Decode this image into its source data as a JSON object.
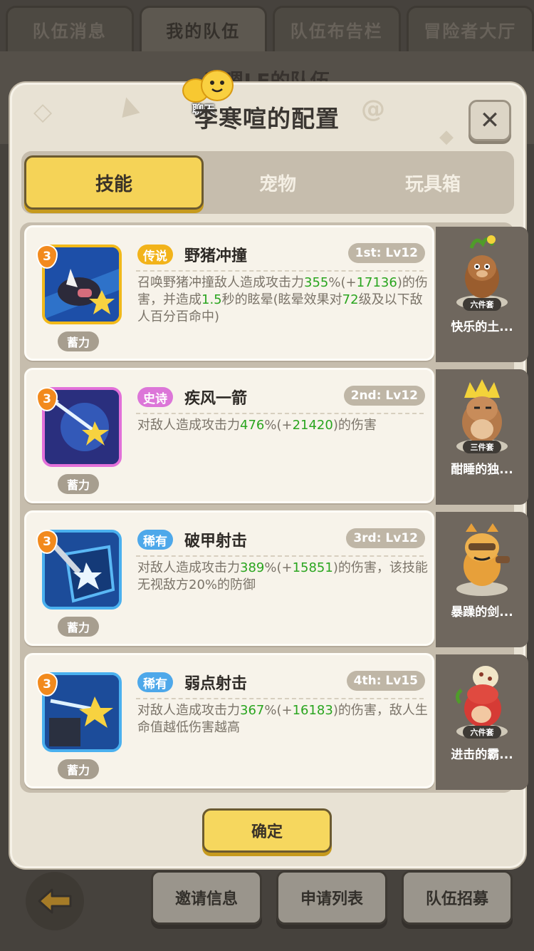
{
  "top_tabs": [
    "队伍消息",
    "我的队伍",
    "队伍布告栏",
    "冒险者大厅"
  ],
  "behind_title": "叫嗯LE的队伍",
  "chat_label": "聊天",
  "dialog_title": "李寒喧的配置",
  "tabs": [
    "技能",
    "宠物",
    "玩具箱"
  ],
  "charge_label": "蓄力",
  "skills": [
    {
      "level": "3",
      "rarity": "传说",
      "rarity_color": "#f2b31a",
      "name": "野猪冲撞",
      "slot": "1st: Lv12",
      "desc": [
        "召唤野猪冲撞敌人造成攻击力",
        "355",
        "%(+",
        "17136",
        ")的伤害，并造成",
        "1.5",
        "秒的眩晕(眩晕效果对",
        "72",
        "级及以下敌人百分百命中)"
      ]
    },
    {
      "level": "3",
      "rarity": "史诗",
      "rarity_color": "#dc76d8",
      "name": "疾风一箭",
      "slot": "2nd: Lv12",
      "desc": [
        "对敌人造成攻击力",
        "476",
        "%(+",
        "21420",
        ")的伤害",
        "",
        "",
        "",
        ""
      ]
    },
    {
      "level": "3",
      "rarity": "稀有",
      "rarity_color": "#4ea8ea",
      "name": "破甲射击",
      "slot": "3rd: Lv12",
      "desc": [
        "对敌人造成攻击力",
        "389",
        "%(+",
        "15851",
        ")的伤害，该技能无视敌方20%的防御",
        "",
        "",
        "",
        ""
      ]
    },
    {
      "level": "3",
      "rarity": "稀有",
      "rarity_color": "#4ea8ea",
      "name": "弱点射击",
      "slot": "4th: Lv15",
      "desc": [
        "对敌人造成攻击力",
        "367",
        "%(+",
        "16183",
        ")的伤害，敌人生命值越低伤害越高",
        "",
        "",
        "",
        ""
      ]
    }
  ],
  "pets": [
    {
      "tag": "六件套",
      "name": "快乐的土..."
    },
    {
      "tag": "三件套",
      "name": "酣睡的独..."
    },
    {
      "tag": "",
      "name": "暴躁的剑..."
    },
    {
      "tag": "六件套",
      "name": "进击的霸..."
    }
  ],
  "confirm_label": "确定",
  "bottom_buttons": [
    "邀请信息",
    "申请列表",
    "队伍招募"
  ]
}
